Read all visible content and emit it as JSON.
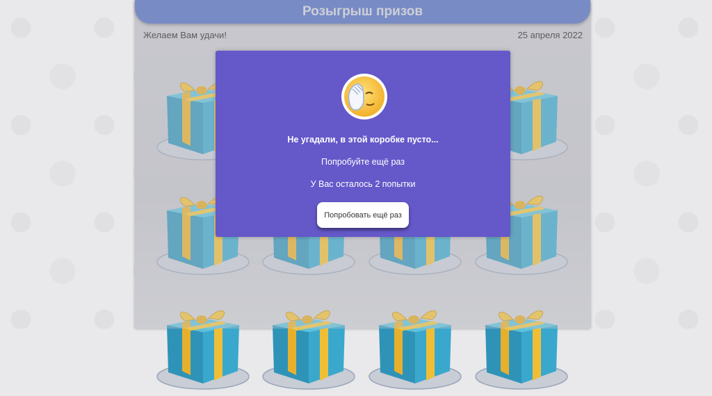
{
  "header": {
    "title": "Розыгрыш призов"
  },
  "subbar": {
    "greeting": "Желаем Вам удачи!",
    "date": "25 апреля 2022"
  },
  "gifts": {
    "rows_visible": 3,
    "per_row": 4
  },
  "modal": {
    "icon": "facepalm-emoji-icon",
    "title": "Не угадали, в этой коробке пусто...",
    "line1": "Попробуйте ещё раз",
    "line2": "У Вас осталось 2 попытки",
    "button_label": "Попробовать ещё раз"
  },
  "colors": {
    "header": "#4d6bc0",
    "modal": "#6558c9",
    "gift_box": "#3aa3c4",
    "ribbon": "#e7b32b"
  }
}
